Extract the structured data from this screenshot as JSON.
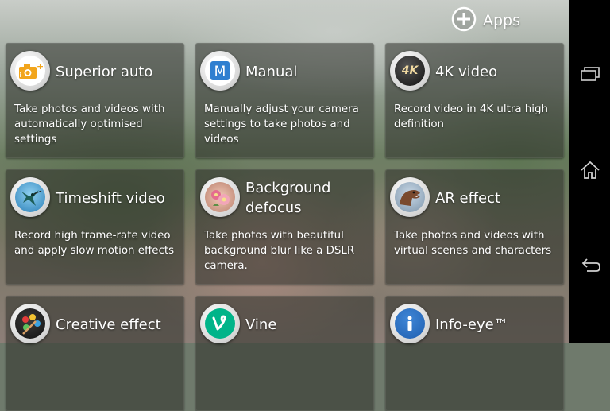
{
  "header": {
    "apps_label": "Apps"
  },
  "modes": [
    {
      "title": "Superior auto",
      "description": "Take photos and videos with automatically optimised settings",
      "icon": "camera-plus-icon"
    },
    {
      "title": "Manual",
      "description": "Manually adjust your camera settings to take photos and videos",
      "icon": "manual-m-icon"
    },
    {
      "title": "4K video",
      "description": "Record video in 4K ultra high definition",
      "icon": "4k-icon",
      "icon_text": "4K"
    },
    {
      "title": "Timeshift video",
      "description": "Record high frame-rate video and apply slow motion effects",
      "icon": "hummingbird-icon"
    },
    {
      "title": "Background defocus",
      "description": "Take photos with beautiful background blur like a DSLR camera.",
      "icon": "flowers-icon"
    },
    {
      "title": "AR effect",
      "description": "Take photos and videos with virtual scenes and characters",
      "icon": "dinosaur-icon"
    },
    {
      "title": "Creative effect",
      "description": "",
      "icon": "palette-icon"
    },
    {
      "title": "Vine",
      "description": "",
      "icon": "vine-icon"
    },
    {
      "title": "Info-eye™",
      "description": "",
      "icon": "info-icon"
    }
  ],
  "navigation": {
    "buttons": [
      "recent-apps-icon",
      "home-icon",
      "back-icon"
    ]
  },
  "colors": {
    "card_bg": "#2d302a",
    "text": "#ffffff",
    "vine_green": "#00b489",
    "info_blue": "#1f5fb0",
    "camera_orange": "#f2a51c"
  }
}
